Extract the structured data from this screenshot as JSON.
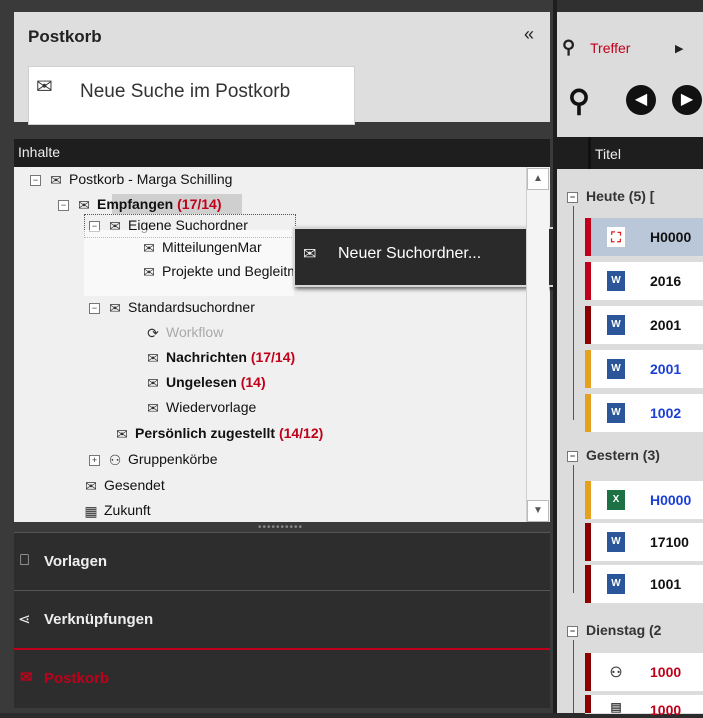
{
  "left_panel": {
    "title": "Postkorb",
    "collapse_icon": "«",
    "search_label": "Neue Suche im Postkorb",
    "contents_header": "Inhalte",
    "tree": {
      "root": "Postkorb - Marga Schilling",
      "empfangen": "Empfangen",
      "empfangen_count": "(17/14)",
      "eigene": "Eigene Suchordner",
      "mitteilungen": "MitteilungenMar",
      "projekte": "Projekte und Begleitmaterial",
      "standard": "Standardsuchordner",
      "workflow": "Workflow",
      "nachrichten": "Nachrichten",
      "nachrichten_count": "(17/14)",
      "ungelesen": "Ungelesen",
      "ungelesen_count": "(14)",
      "wiedervorlage": "Wiedervorlage",
      "persoenlich": "Persönlich zugestellt",
      "persoenlich_count": "(14/12)",
      "gruppen": "Gruppenkörbe",
      "gesendet": "Gesendet",
      "zukunft": "Zukunft"
    },
    "context_menu": {
      "item": "Neuer Suchordner..."
    },
    "nav": {
      "vorlagen": "Vorlagen",
      "verknuepfungen": "Verknüpfungen",
      "postkorb": "Postkorb"
    }
  },
  "right_panel": {
    "treffer_label": "Treffer",
    "column_title": "Titel",
    "groups": {
      "heute": "Heute (5)",
      "heute_extra": "[",
      "gestern": "Gestern (3)",
      "dienstag": "Dienstag (2"
    },
    "rows": [
      {
        "text": "H0000",
        "color": "#111111"
      },
      {
        "text": "2016",
        "color": "#111111"
      },
      {
        "text": "2001",
        "color": "#111111"
      },
      {
        "text": "2001",
        "color": "#1a3fd6"
      },
      {
        "text": "1002",
        "color": "#1a3fd6"
      },
      {
        "text": "H0000",
        "color": "#1a3fd6"
      },
      {
        "text": "17100",
        "color": "#111111"
      },
      {
        "text": "1001",
        "color": "#111111"
      },
      {
        "text": "1000",
        "color": "#c0001a"
      },
      {
        "text": "1000",
        "color": "#c0001a"
      }
    ]
  },
  "colors": {
    "accent_red": "#c0001a",
    "link_blue": "#1a3fd6"
  }
}
